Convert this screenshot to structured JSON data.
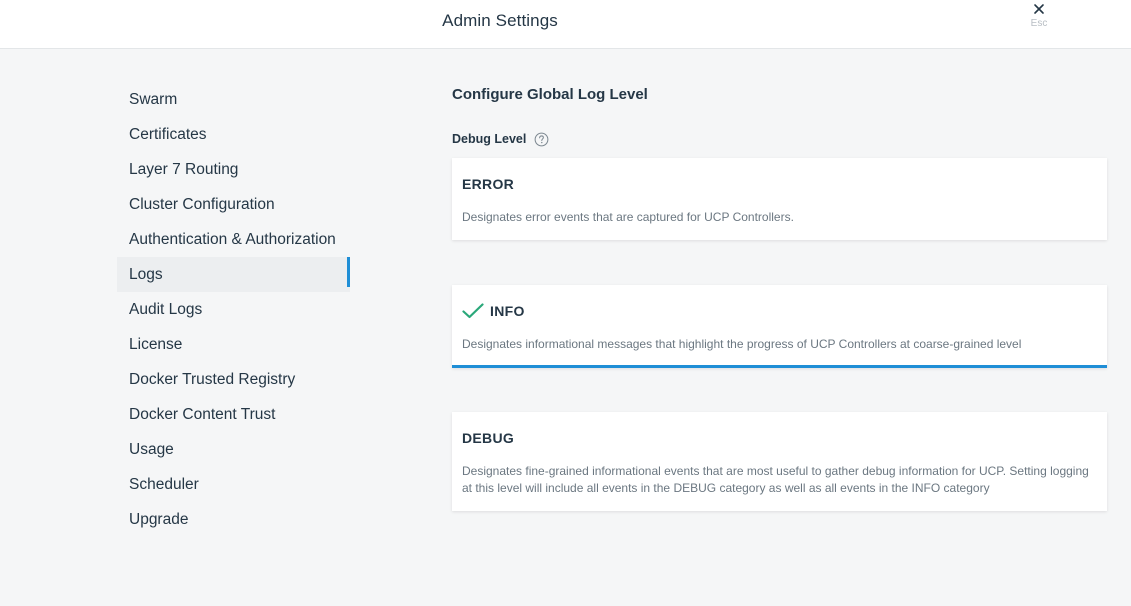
{
  "header": {
    "title": "Admin Settings",
    "close_label": "Esc"
  },
  "sidebar": {
    "items": [
      {
        "label": "Swarm"
      },
      {
        "label": "Certificates"
      },
      {
        "label": "Layer 7 Routing"
      },
      {
        "label": "Cluster Configuration"
      },
      {
        "label": "Authentication & Authorization"
      },
      {
        "label": "Logs",
        "active": true
      },
      {
        "label": "Audit Logs"
      },
      {
        "label": "License"
      },
      {
        "label": "Docker Trusted Registry"
      },
      {
        "label": "Docker Content Trust"
      },
      {
        "label": "Usage"
      },
      {
        "label": "Scheduler"
      },
      {
        "label": "Upgrade"
      }
    ]
  },
  "main": {
    "title": "Configure Global Log Level",
    "debug_label": "Debug Level",
    "levels": [
      {
        "name": "ERROR",
        "description": "Designates error events that are captured for UCP Controllers.",
        "selected": false
      },
      {
        "name": "INFO",
        "description": "Designates informational messages that highlight the progress of UCP Controllers at coarse-grained level",
        "selected": true
      },
      {
        "name": "DEBUG",
        "description": "Designates fine-grained informational events that are most useful to gather debug information for UCP. Setting logging at this level will include all events in the DEBUG category as well as all events in the INFO category",
        "selected": false
      }
    ]
  },
  "colors": {
    "accent": "#1f8ed6",
    "check": "#2aa87a",
    "text": "#253746",
    "muted": "#6b7781"
  },
  "icons": {
    "close": "close-icon",
    "help": "question-circle-icon",
    "check": "checkmark-icon"
  }
}
